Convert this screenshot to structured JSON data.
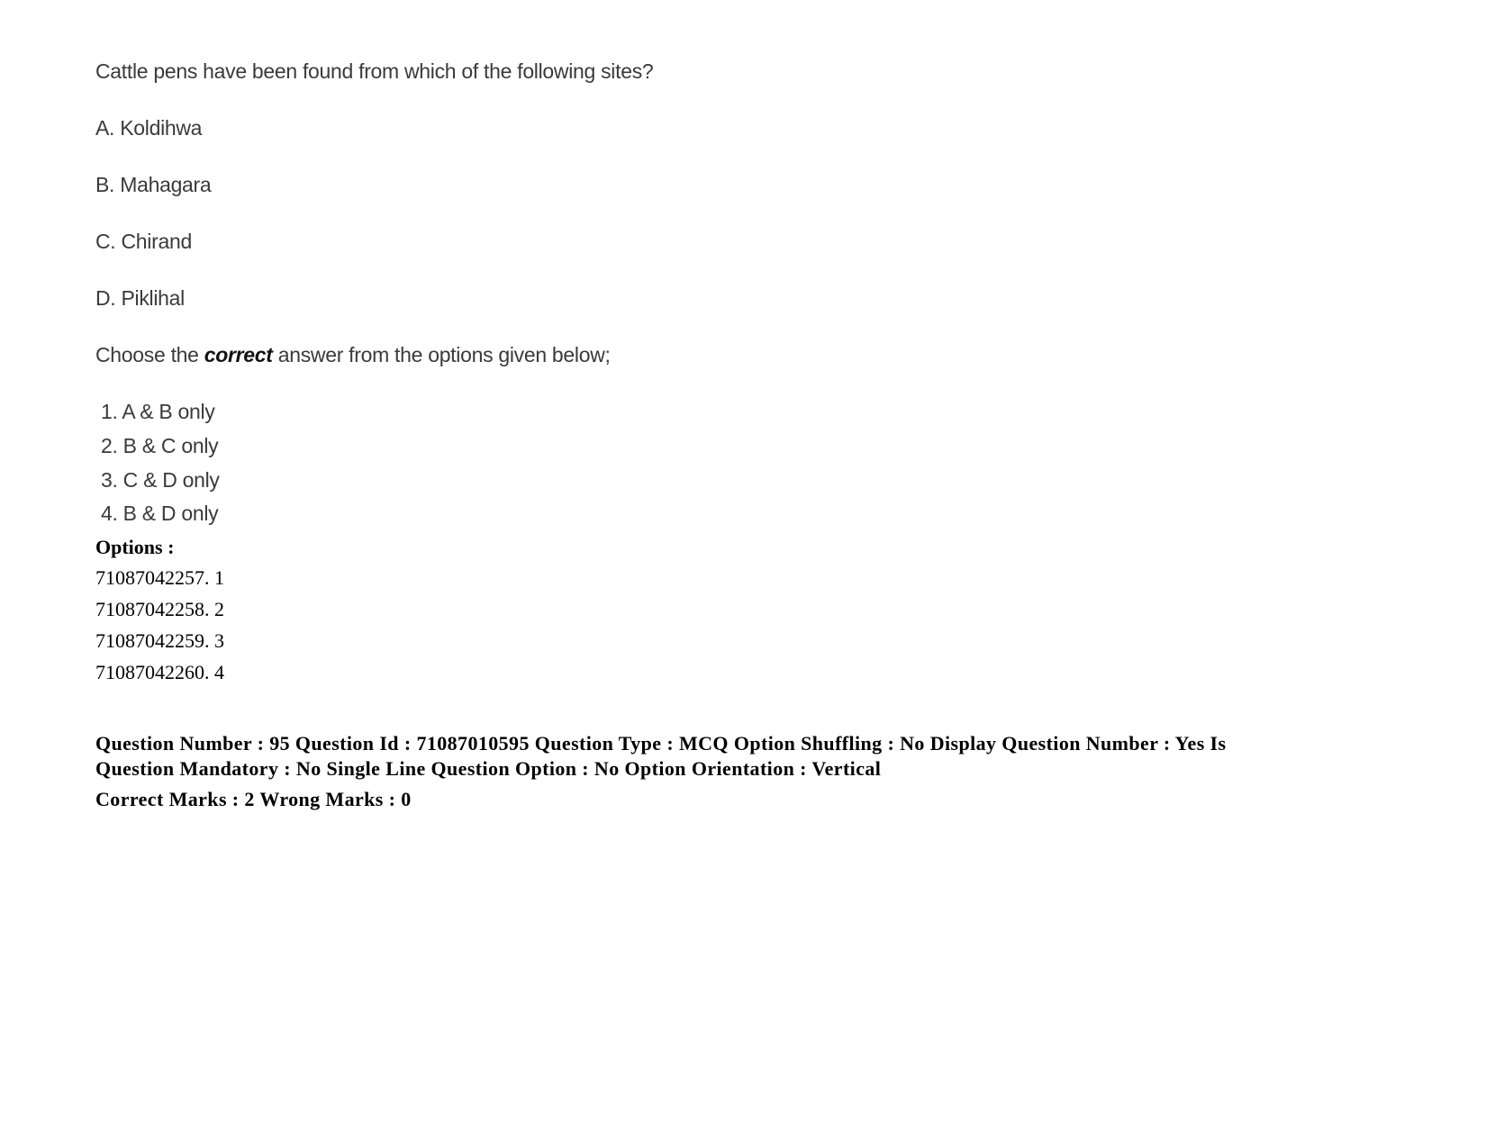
{
  "question": {
    "text": "Cattle pens have been found from which of the following sites?",
    "statements": [
      {
        "label": "A.",
        "text": "Koldihwa"
      },
      {
        "label": "B.",
        "text": "Mahagara"
      },
      {
        "label": "C.",
        "text": "Chirand"
      },
      {
        "label": "D.",
        "text": "Piklihal"
      }
    ],
    "instruction": {
      "before": "Choose the ",
      "emphasis": "correct",
      "after": " answer from the options given below;"
    },
    "choices": [
      "1. A & B only",
      "2. B & C only",
      "3. C & D only",
      "4. B & D only"
    ]
  },
  "options": {
    "heading": "Options :",
    "items": [
      "71087042257. 1",
      "71087042258. 2",
      "71087042259. 3",
      "71087042260. 4"
    ]
  },
  "metadata": {
    "line1": "Question Number : 95 Question Id : 71087010595 Question Type : MCQ Option Shuffling : No Display Question Number : Yes Is",
    "line2": "Question Mandatory : No Single Line Question Option : No Option Orientation : Vertical",
    "marks": "Correct Marks : 2 Wrong Marks : 0"
  }
}
